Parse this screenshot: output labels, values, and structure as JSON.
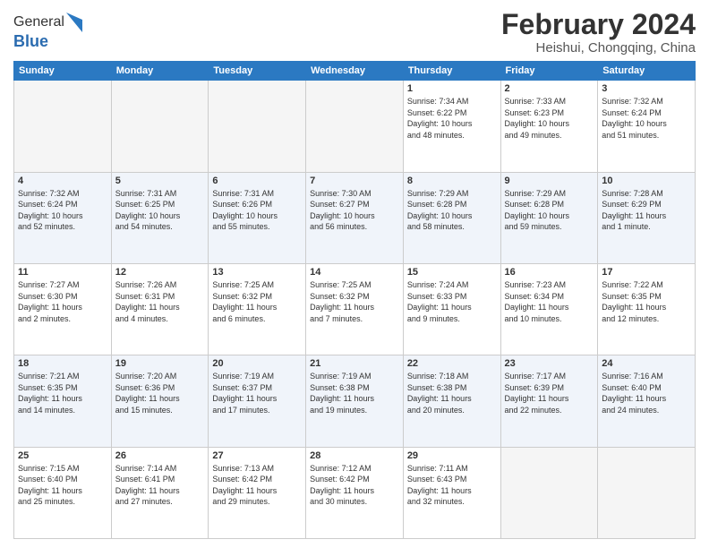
{
  "header": {
    "logo": {
      "general": "General",
      "blue": "Blue",
      "tagline": "GeneralBlue"
    },
    "title": "February 2024",
    "subtitle": "Heishui, Chongqing, China"
  },
  "weekdays": [
    "Sunday",
    "Monday",
    "Tuesday",
    "Wednesday",
    "Thursday",
    "Friday",
    "Saturday"
  ],
  "rows": [
    [
      {
        "day": "",
        "info": ""
      },
      {
        "day": "",
        "info": ""
      },
      {
        "day": "",
        "info": ""
      },
      {
        "day": "",
        "info": ""
      },
      {
        "day": "1",
        "info": "Sunrise: 7:34 AM\nSunset: 6:22 PM\nDaylight: 10 hours\nand 48 minutes."
      },
      {
        "day": "2",
        "info": "Sunrise: 7:33 AM\nSunset: 6:23 PM\nDaylight: 10 hours\nand 49 minutes."
      },
      {
        "day": "3",
        "info": "Sunrise: 7:32 AM\nSunset: 6:24 PM\nDaylight: 10 hours\nand 51 minutes."
      }
    ],
    [
      {
        "day": "4",
        "info": "Sunrise: 7:32 AM\nSunset: 6:24 PM\nDaylight: 10 hours\nand 52 minutes."
      },
      {
        "day": "5",
        "info": "Sunrise: 7:31 AM\nSunset: 6:25 PM\nDaylight: 10 hours\nand 54 minutes."
      },
      {
        "day": "6",
        "info": "Sunrise: 7:31 AM\nSunset: 6:26 PM\nDaylight: 10 hours\nand 55 minutes."
      },
      {
        "day": "7",
        "info": "Sunrise: 7:30 AM\nSunset: 6:27 PM\nDaylight: 10 hours\nand 56 minutes."
      },
      {
        "day": "8",
        "info": "Sunrise: 7:29 AM\nSunset: 6:28 PM\nDaylight: 10 hours\nand 58 minutes."
      },
      {
        "day": "9",
        "info": "Sunrise: 7:29 AM\nSunset: 6:28 PM\nDaylight: 10 hours\nand 59 minutes."
      },
      {
        "day": "10",
        "info": "Sunrise: 7:28 AM\nSunset: 6:29 PM\nDaylight: 11 hours\nand 1 minute."
      }
    ],
    [
      {
        "day": "11",
        "info": "Sunrise: 7:27 AM\nSunset: 6:30 PM\nDaylight: 11 hours\nand 2 minutes."
      },
      {
        "day": "12",
        "info": "Sunrise: 7:26 AM\nSunset: 6:31 PM\nDaylight: 11 hours\nand 4 minutes."
      },
      {
        "day": "13",
        "info": "Sunrise: 7:25 AM\nSunset: 6:32 PM\nDaylight: 11 hours\nand 6 minutes."
      },
      {
        "day": "14",
        "info": "Sunrise: 7:25 AM\nSunset: 6:32 PM\nDaylight: 11 hours\nand 7 minutes."
      },
      {
        "day": "15",
        "info": "Sunrise: 7:24 AM\nSunset: 6:33 PM\nDaylight: 11 hours\nand 9 minutes."
      },
      {
        "day": "16",
        "info": "Sunrise: 7:23 AM\nSunset: 6:34 PM\nDaylight: 11 hours\nand 10 minutes."
      },
      {
        "day": "17",
        "info": "Sunrise: 7:22 AM\nSunset: 6:35 PM\nDaylight: 11 hours\nand 12 minutes."
      }
    ],
    [
      {
        "day": "18",
        "info": "Sunrise: 7:21 AM\nSunset: 6:35 PM\nDaylight: 11 hours\nand 14 minutes."
      },
      {
        "day": "19",
        "info": "Sunrise: 7:20 AM\nSunset: 6:36 PM\nDaylight: 11 hours\nand 15 minutes."
      },
      {
        "day": "20",
        "info": "Sunrise: 7:19 AM\nSunset: 6:37 PM\nDaylight: 11 hours\nand 17 minutes."
      },
      {
        "day": "21",
        "info": "Sunrise: 7:19 AM\nSunset: 6:38 PM\nDaylight: 11 hours\nand 19 minutes."
      },
      {
        "day": "22",
        "info": "Sunrise: 7:18 AM\nSunset: 6:38 PM\nDaylight: 11 hours\nand 20 minutes."
      },
      {
        "day": "23",
        "info": "Sunrise: 7:17 AM\nSunset: 6:39 PM\nDaylight: 11 hours\nand 22 minutes."
      },
      {
        "day": "24",
        "info": "Sunrise: 7:16 AM\nSunset: 6:40 PM\nDaylight: 11 hours\nand 24 minutes."
      }
    ],
    [
      {
        "day": "25",
        "info": "Sunrise: 7:15 AM\nSunset: 6:40 PM\nDaylight: 11 hours\nand 25 minutes."
      },
      {
        "day": "26",
        "info": "Sunrise: 7:14 AM\nSunset: 6:41 PM\nDaylight: 11 hours\nand 27 minutes."
      },
      {
        "day": "27",
        "info": "Sunrise: 7:13 AM\nSunset: 6:42 PM\nDaylight: 11 hours\nand 29 minutes."
      },
      {
        "day": "28",
        "info": "Sunrise: 7:12 AM\nSunset: 6:42 PM\nDaylight: 11 hours\nand 30 minutes."
      },
      {
        "day": "29",
        "info": "Sunrise: 7:11 AM\nSunset: 6:43 PM\nDaylight: 11 hours\nand 32 minutes."
      },
      {
        "day": "",
        "info": ""
      },
      {
        "day": "",
        "info": ""
      }
    ]
  ]
}
